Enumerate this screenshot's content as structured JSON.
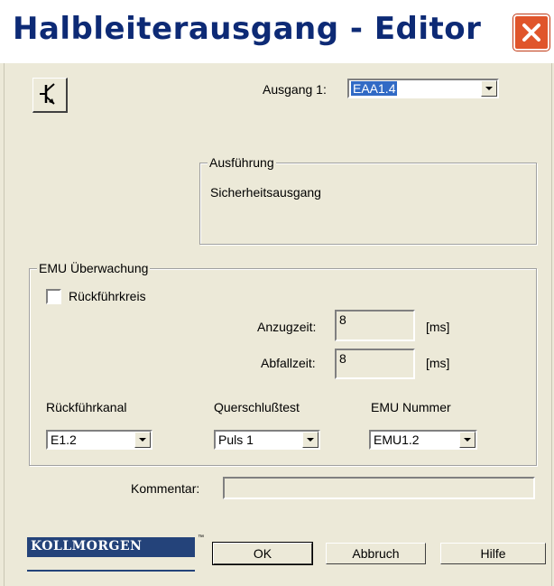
{
  "window": {
    "title": "Halbleiterausgang - Editor"
  },
  "output": {
    "label": "Ausgang 1:",
    "value": "EAA1.4"
  },
  "execution": {
    "legend": "Ausführung",
    "text": "Sicherheitsausgang"
  },
  "emu": {
    "legend": "EMU Überwachung",
    "feedback_loop_label": "Rückführkreis",
    "feedback_loop_checked": false,
    "pickup_label": "Anzugzeit:",
    "pickup_value": "8",
    "pickup_unit": "[ms]",
    "dropout_label": "Abfallzeit:",
    "dropout_value": "8",
    "dropout_unit": "[ms]",
    "channel_label": "Rückführkanal",
    "channel_value": "E1.2",
    "crosstest_label": "Querschlußtest",
    "crosstest_value": "Puls 1",
    "number_label": "EMU Nummer",
    "number_value": "EMU1.2"
  },
  "comment": {
    "label": "Kommentar:",
    "value": ""
  },
  "branding": {
    "logo_text": "KOLLMORGEN",
    "trademark": "™"
  },
  "buttons": {
    "ok": "OK",
    "cancel": "Abbruch",
    "help": "Hilfe"
  },
  "colors": {
    "title_text": "#0d2a75",
    "close_button": "#e0552b",
    "dialog_bg": "#ece9d8",
    "selection": "#316ac5",
    "logo": "#24437a"
  },
  "icons": {
    "component": "transistor-icon",
    "close": "close-icon"
  }
}
